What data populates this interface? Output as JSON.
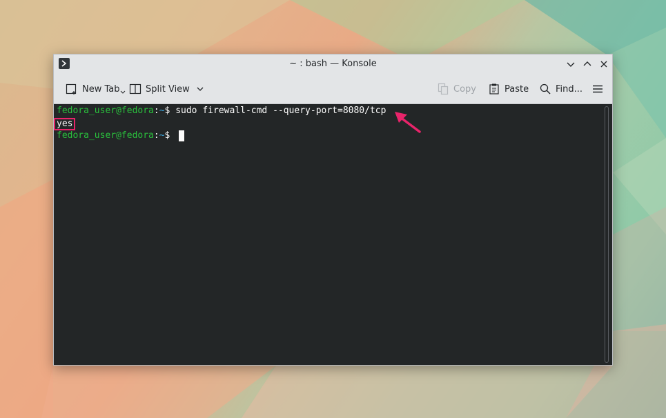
{
  "window": {
    "title": "~ : bash — Konsole"
  },
  "toolbar": {
    "new_tab_label": "New Tab",
    "split_view_label": "Split View",
    "copy_label": "Copy",
    "paste_label": "Paste",
    "find_label": "Find..."
  },
  "terminal": {
    "lines": [
      {
        "user": "fedora_user@fedora",
        "sep": ":",
        "path": "~",
        "prompt": "$",
        "command": " sudo firewall-cmd --query-port=8080/tcp"
      },
      {
        "output": "yes"
      },
      {
        "user": "fedora_user@fedora",
        "sep": ":",
        "path": "~",
        "prompt": "$",
        "command": " "
      }
    ]
  },
  "colors": {
    "prompt_user": "#2ac13d",
    "prompt_path": "#3daee9",
    "terminal_bg": "#232627",
    "highlight": "#e8246a"
  },
  "icons": [
    "konsole-icon",
    "minimize-icon",
    "maximize-icon",
    "close-icon",
    "new-tab-icon",
    "split-view-icon",
    "chevron-down-icon",
    "copy-icon",
    "paste-icon",
    "search-icon",
    "hamburger-menu-icon",
    "arrow-annotation-icon"
  ]
}
